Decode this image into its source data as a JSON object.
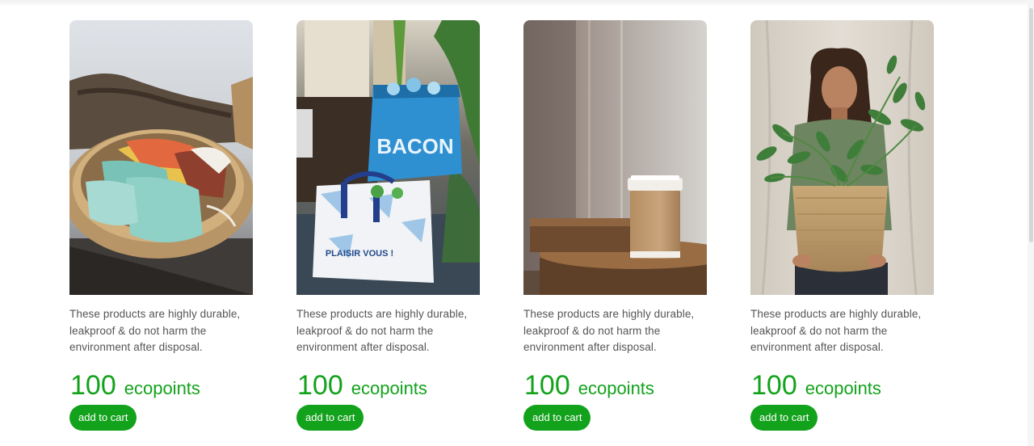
{
  "products": [
    {
      "image": "cloth-face-masks-in-wicker-basket",
      "description": "These products are highly durable, leakproof & do not harm the environment after disposal.",
      "price": "100",
      "unit": "ecopoints",
      "button_label": "add to cart"
    },
    {
      "image": "reusable-shopping-bags-with-bottles",
      "description": "These products are highly durable, leakproof & do not harm the environment after disposal.",
      "price": "100",
      "unit": "ecopoints",
      "button_label": "add to cart"
    },
    {
      "image": "paper-coffee-cup-on-wooden-table",
      "description": "These products are highly durable, leakproof & do not harm the environment after disposal.",
      "price": "100",
      "unit": "ecopoints",
      "button_label": "add to cart"
    },
    {
      "image": "woman-holding-potted-plant-in-woven-basket",
      "description": "These products are highly durable, leakproof & do not harm the environment after disposal.",
      "price": "100",
      "unit": "ecopoints",
      "button_label": "add to cart"
    }
  ],
  "colors": {
    "accent": "#13a21c",
    "text": "#555555"
  },
  "images": {
    "product-1": {
      "bag_text_1": "",
      "bag_text_2": ""
    },
    "product-2": {
      "bag_text_1": "BACON",
      "bag_text_2": "PLAISIR VOUS !"
    }
  }
}
